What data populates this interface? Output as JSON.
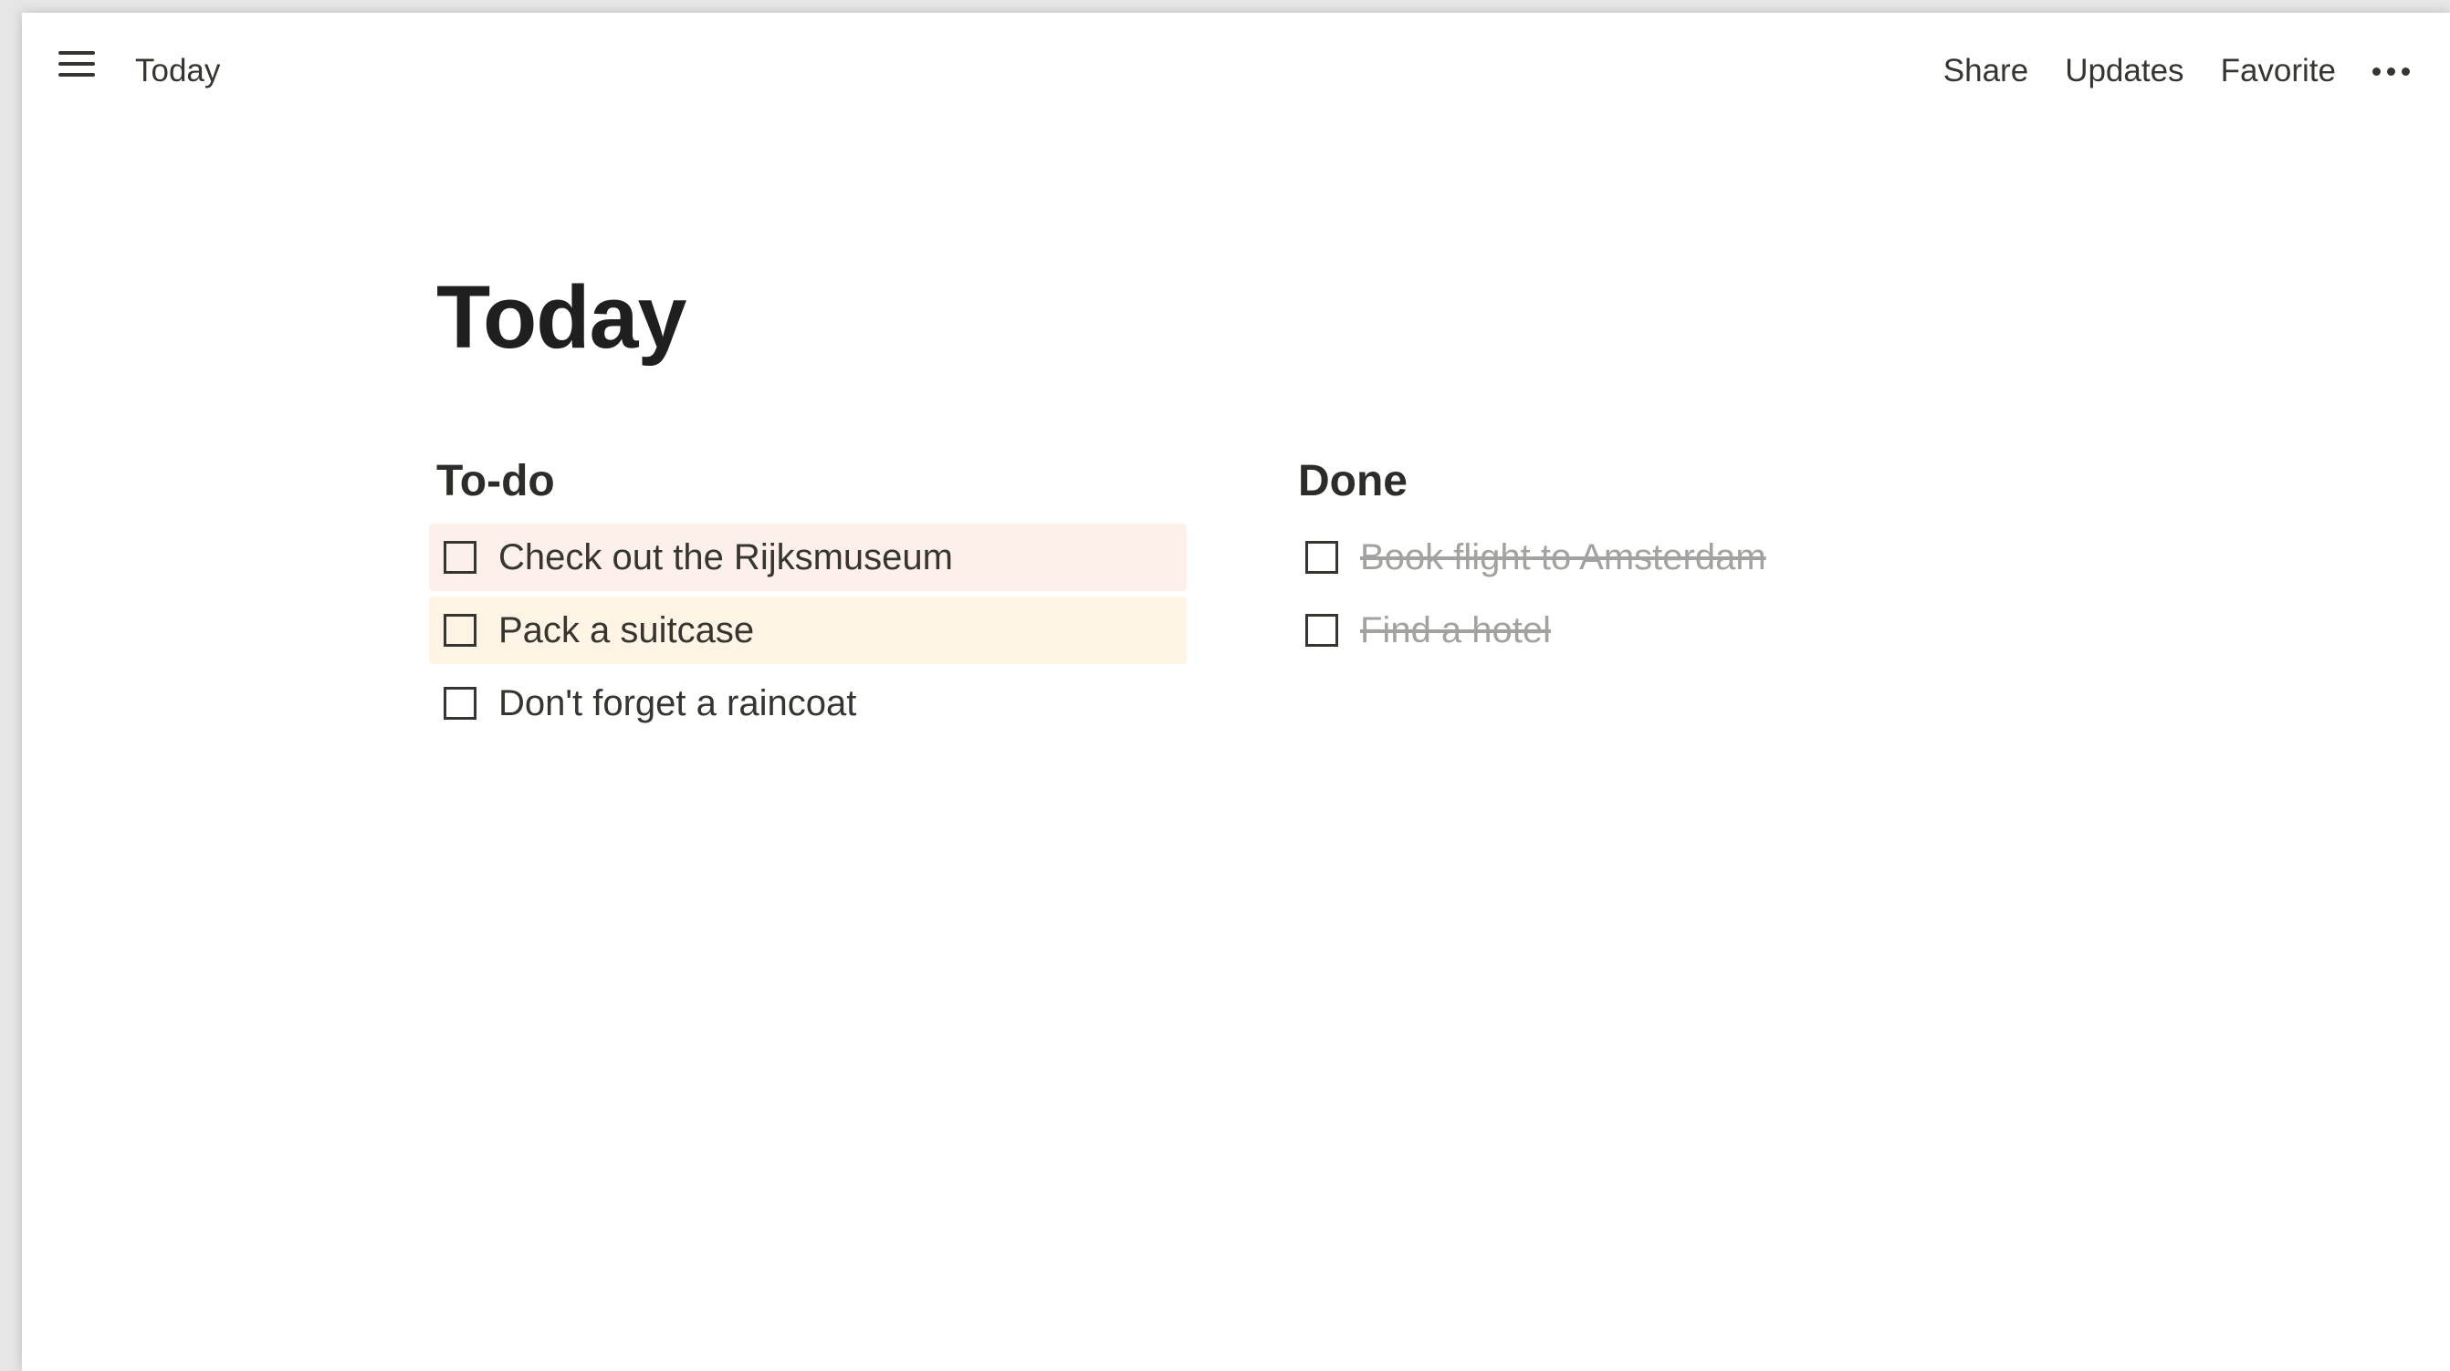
{
  "header": {
    "breadcrumb": "Today",
    "actions": {
      "share": "Share",
      "updates": "Updates",
      "favorite": "Favorite"
    },
    "icons": {
      "menu": "hamburger-menu-icon",
      "more": "more-options-icon"
    }
  },
  "page": {
    "title": "Today"
  },
  "todo": {
    "heading": "To-do",
    "items": [
      {
        "label": "Check out the Rijksmuseum",
        "checked": false,
        "highlight": "#fdf0ea"
      },
      {
        "label": "Pack a suitcase",
        "checked": false,
        "highlight": "#fdf4e6"
      },
      {
        "label": "Don't forget a raincoat",
        "checked": false,
        "highlight": ""
      }
    ]
  },
  "done": {
    "heading": "Done",
    "items": [
      {
        "label": "Book flight to Amsterdam",
        "checked": true
      },
      {
        "label": "Find a hotel",
        "checked": true
      }
    ]
  },
  "colors": {
    "checkbox_checked": "#2e8ee0",
    "text": "#37352f",
    "done_text": "#a3a29e"
  }
}
